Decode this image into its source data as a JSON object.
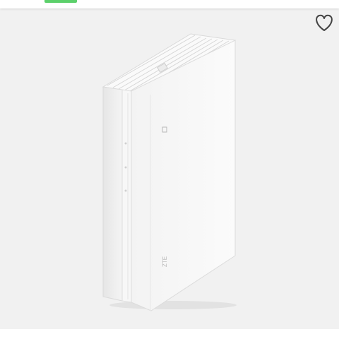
{
  "product": {
    "image_icon": "router-device-image",
    "brand_mark": "ZTE"
  },
  "actions": {
    "favorite_icon": "heart-outline-icon"
  },
  "colors": {
    "accent_badge": "#5cd06b",
    "background": "#f1f1f1"
  }
}
